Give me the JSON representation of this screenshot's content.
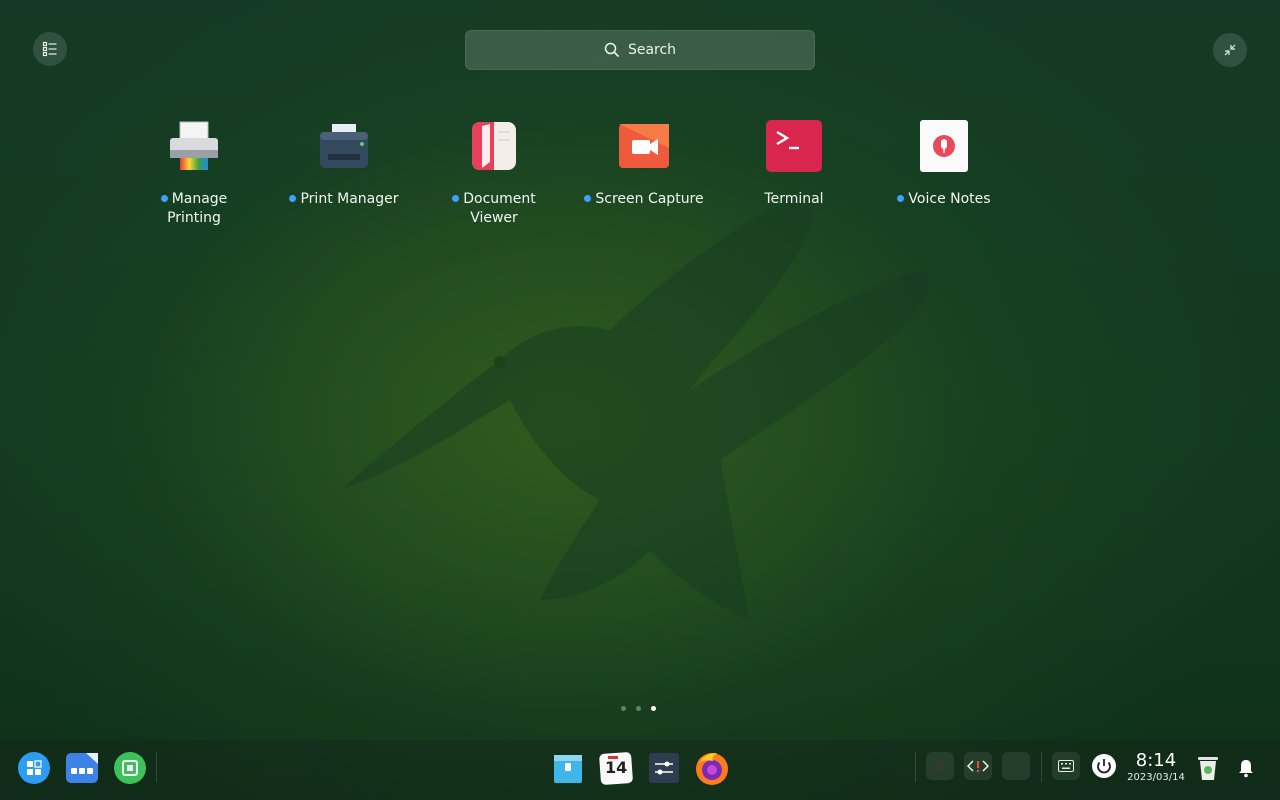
{
  "search": {
    "label": "Search"
  },
  "apps": [
    {
      "label": "Manage Printing",
      "icon": "printer-color-icon",
      "new": true
    },
    {
      "label": "Print Manager",
      "icon": "print-manager-icon",
      "new": true
    },
    {
      "label": "Document Viewer",
      "icon": "document-viewer-icon",
      "new": true
    },
    {
      "label": "Screen Capture",
      "icon": "screen-capture-icon",
      "new": true
    },
    {
      "label": "Terminal",
      "icon": "terminal-icon",
      "new": false
    },
    {
      "label": "Voice Notes",
      "icon": "voice-notes-icon",
      "new": true
    }
  ],
  "pager": {
    "pages": 3,
    "current": 3
  },
  "dock": {
    "left": [
      "launcher-icon",
      "multitask-view-icon",
      "app-store-icon"
    ],
    "center": [
      "file-manager-icon",
      "calendar-icon",
      "control-center-icon",
      "firefox-icon"
    ],
    "calendar_day": "14",
    "tray": [
      "tray-app-icon",
      "code-dev-icon",
      "tray-blank-icon",
      "keyboard-icon",
      "power-icon"
    ],
    "clock": {
      "time": "8:14",
      "date": "2023/03/14"
    },
    "right": [
      "trash-icon",
      "notification-bell-icon"
    ]
  },
  "colors": {
    "accent": "#3ea0ff",
    "terminal": "#d9264f",
    "capture": "#ef5a3c"
  }
}
